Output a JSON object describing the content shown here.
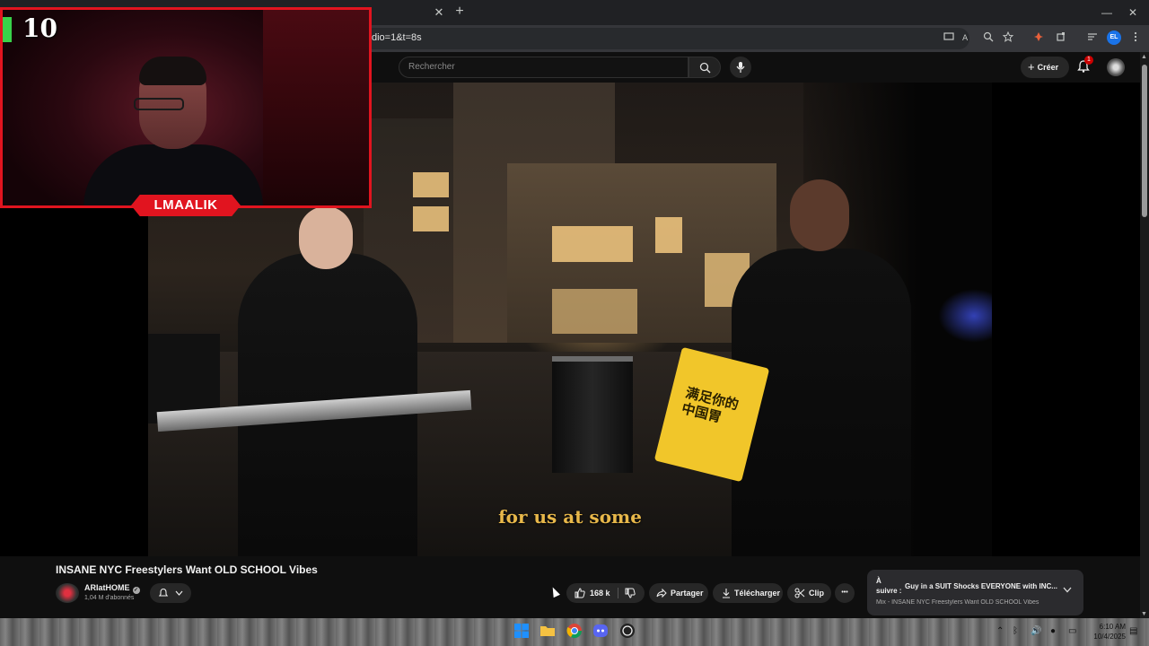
{
  "browser": {
    "url_fragment": "dio=1&t=8s",
    "tab_close_glyph": "✕",
    "new_tab_glyph": "+",
    "profile_initials": "EL",
    "window_controls": [
      "—",
      "❐",
      "✕"
    ]
  },
  "youtube": {
    "search_placeholder": "Rechercher",
    "create_label": "Créer",
    "notification_count": "1"
  },
  "webcam": {
    "counter": "10",
    "streamer_name": "LMAALIK"
  },
  "video": {
    "subtitle": "for us at some",
    "bag_text": "满足你的\n中国胃",
    "title": "INSANE NYC Freestylers Want OLD SCHOOL Vibes",
    "channel": "ARIatHOME",
    "subscribers": "1,04 M d'abonnés",
    "likes": "168 k",
    "share_label": "Partager",
    "download_label": "Télécharger",
    "clip_label": "Clip",
    "more_label": "•••"
  },
  "up_next": {
    "label": "À suivre :",
    "title": "Guy in a SUIT Shocks EVERYONE with INC...",
    "subtitle": "Mix - INSANE NYC Freestylers Want OLD SCHOOL Vibes"
  },
  "taskbar": {
    "time": "6:10 AM",
    "date": "10/4/2025"
  },
  "colors": {
    "accent_red": "#e1141f",
    "subtitle_gold": "#e8b84a",
    "bag_yellow": "#f1c62a"
  }
}
